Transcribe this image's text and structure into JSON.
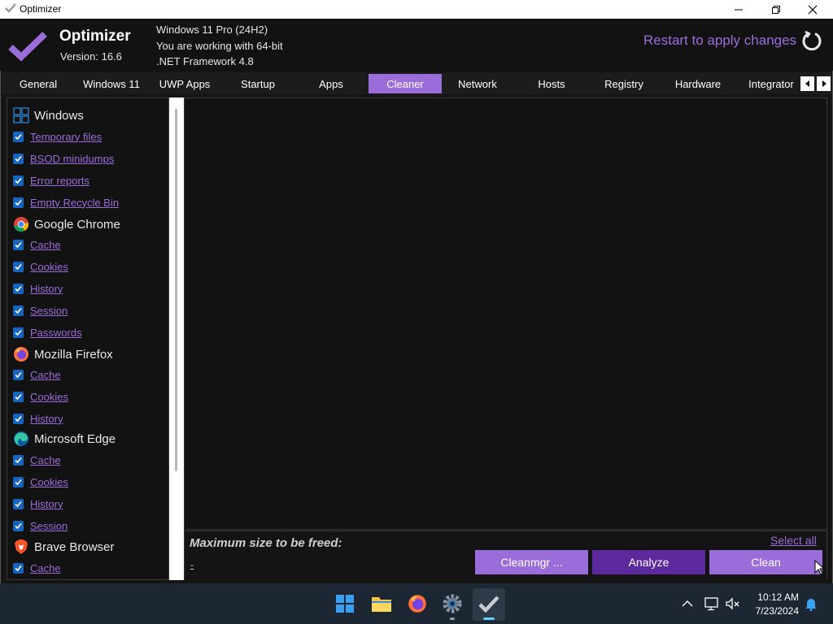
{
  "window": {
    "title": "Optimizer"
  },
  "header": {
    "app_name": "Optimizer",
    "version": "Version: 16.6",
    "system_lines": [
      "Windows 11 Pro (24H2)",
      "You are working with 64-bit",
      ".NET Framework 4.8"
    ],
    "restart_text": "Restart to apply changes"
  },
  "tabs": [
    {
      "label": "General"
    },
    {
      "label": "Windows 11"
    },
    {
      "label": "UWP Apps"
    },
    {
      "label": "Startup"
    },
    {
      "label": "Apps"
    },
    {
      "label": "Cleaner",
      "active": true
    },
    {
      "label": "Network"
    },
    {
      "label": "Hosts"
    },
    {
      "label": "Registry"
    },
    {
      "label": "Hardware"
    },
    {
      "label": "Integrator"
    }
  ],
  "cleaner": {
    "groups": [
      {
        "name": "Windows",
        "icon": "windows-icon",
        "items": [
          "Temporary files",
          "BSOD minidumps",
          "Error reports",
          "Empty Recycle Bin"
        ]
      },
      {
        "name": "Google Chrome",
        "icon": "chrome-icon",
        "items": [
          "Cache",
          "Cookies",
          "History",
          "Session",
          "Passwords"
        ]
      },
      {
        "name": "Mozilla Firefox",
        "icon": "firefox-icon",
        "items": [
          "Cache",
          "Cookies",
          "History"
        ]
      },
      {
        "name": "Microsoft Edge",
        "icon": "edge-icon",
        "items": [
          "Cache",
          "Cookies",
          "History",
          "Session"
        ]
      },
      {
        "name": "Brave Browser",
        "icon": "brave-icon",
        "items": [
          "Cache"
        ]
      }
    ],
    "max_size_label": "Maximum size to be freed:",
    "max_size_value": "-",
    "select_all": "Select all",
    "buttons": {
      "cleanmgr": "Cleanmgr ...",
      "analyze": "Analyze",
      "clean": "Clean"
    }
  },
  "taskbar": {
    "time": "10:12 AM",
    "date": "7/23/2024"
  },
  "colors": {
    "accent": "#9b6ddb",
    "checkbox": "#1565c0",
    "background": "#121212",
    "taskbar": "#1c2733"
  }
}
